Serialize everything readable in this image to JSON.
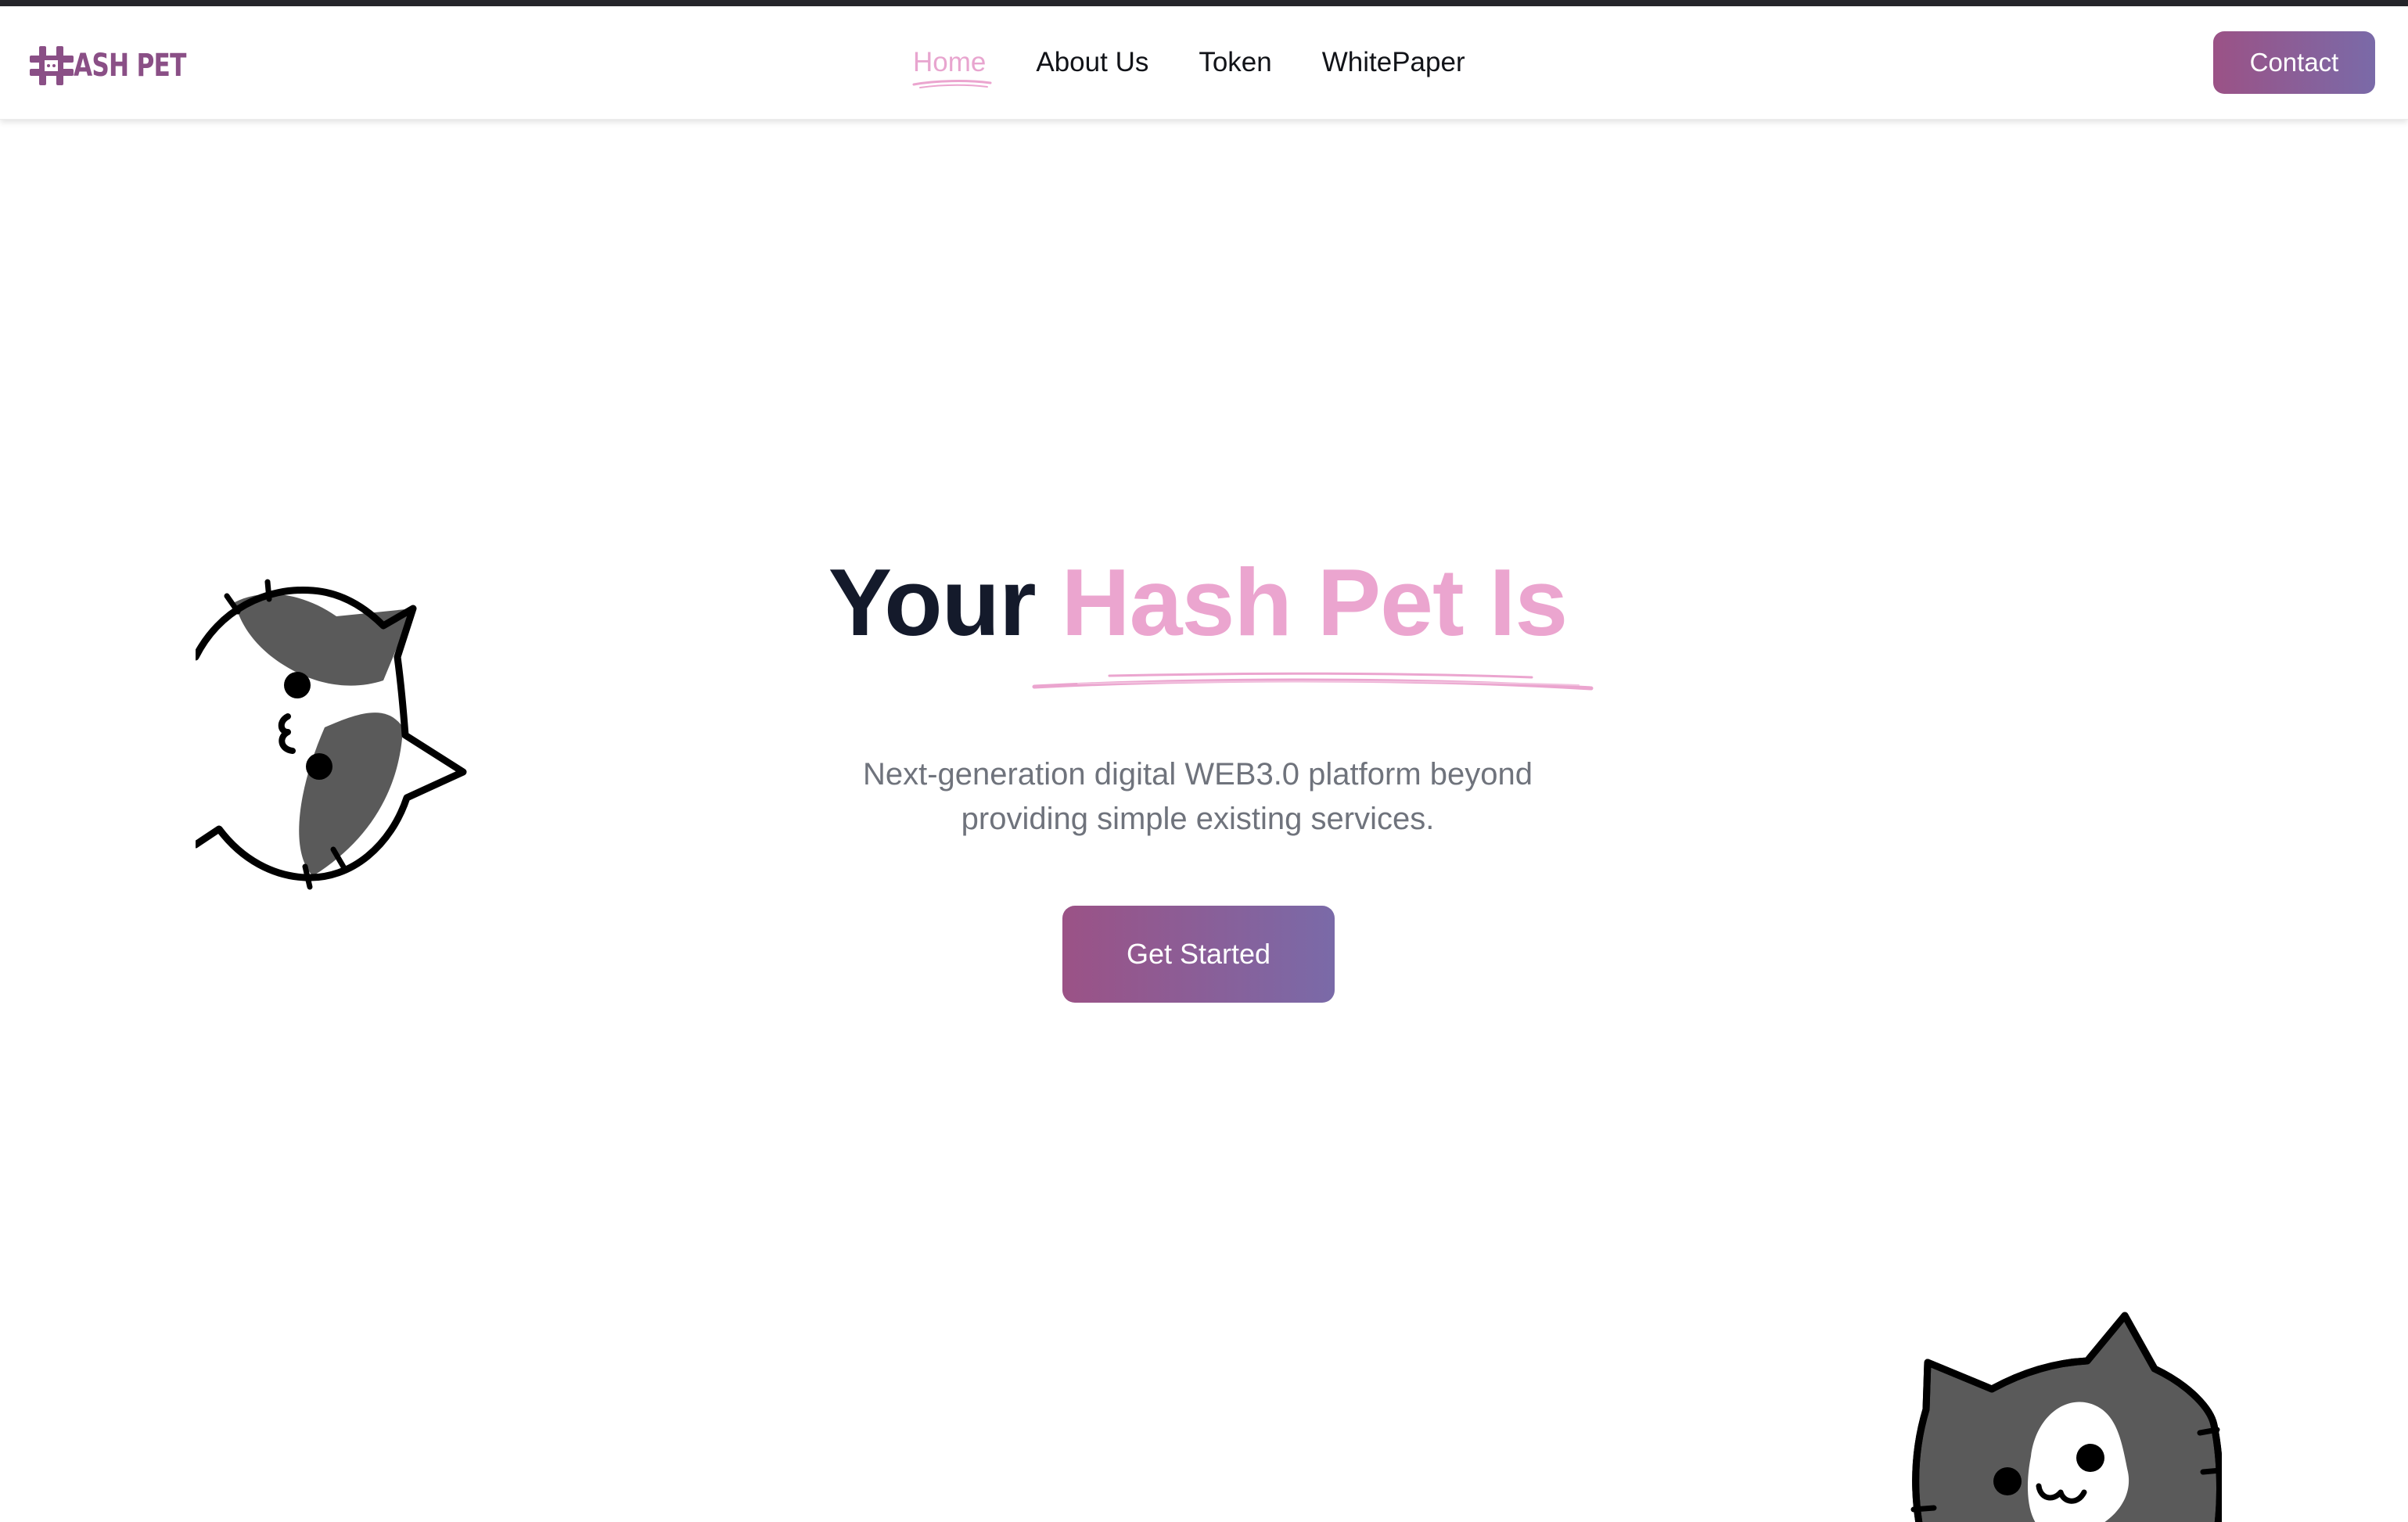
{
  "brand": {
    "logo_text": "ASH PET"
  },
  "nav": {
    "items": [
      {
        "label": "Home",
        "active": true
      },
      {
        "label": "About Us",
        "active": false
      },
      {
        "label": "Token",
        "active": false
      },
      {
        "label": "WhitePaper",
        "active": false
      }
    ],
    "contact_label": "Contact"
  },
  "hero": {
    "title_dark": "Your",
    "title_accent": "Hash Pet Is",
    "subtitle_line1": "Next-generation digital WEB3.0 platform beyond",
    "subtitle_line2": "providing simple existing services.",
    "cta_label": "Get Started"
  },
  "colors": {
    "accent_pink": "#eba5cf",
    "button_gradient_start": "#9b5286",
    "button_gradient_end": "#7a6aa8",
    "title_dark": "#141a2b",
    "subtitle_gray": "#6f737c"
  },
  "icons": {
    "logo": "hash-pet-logo",
    "cat_left": "cat-head-rotated-icon",
    "cat_right": "cat-head-peeking-icon"
  }
}
